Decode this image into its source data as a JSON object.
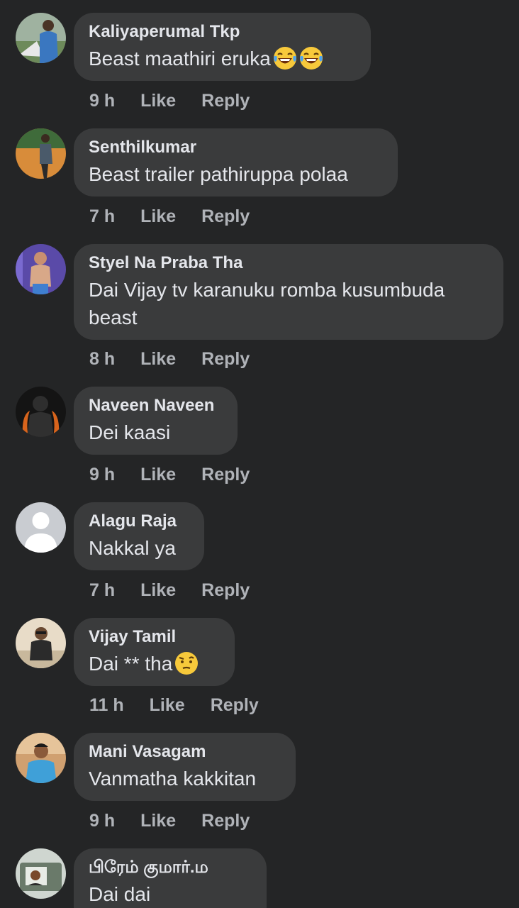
{
  "comments": [
    {
      "author": "Kaliyaperumal Tkp",
      "text": "Beast maathiri eruka",
      "emoji": [
        "face-with-tears-of-joy",
        "face-with-tears-of-joy"
      ],
      "time": "9 h",
      "like": "Like",
      "reply": "Reply"
    },
    {
      "author": "Senthilkumar",
      "text": "Beast trailer pathiruppa polaa",
      "time": "7 h",
      "like": "Like",
      "reply": "Reply"
    },
    {
      "author": "Styel Na Praba Tha",
      "text": "Dai Vijay tv karanuku romba kusumbuda beast",
      "time": "8 h",
      "like": "Like",
      "reply": "Reply"
    },
    {
      "author": "Naveen Naveen",
      "text": "Dei kaasi",
      "time": "9 h",
      "like": "Like",
      "reply": "Reply"
    },
    {
      "author": "Alagu Raja",
      "text": "Nakkal ya",
      "time": "7 h",
      "like": "Like",
      "reply": "Reply"
    },
    {
      "author": "Vijay Tamil",
      "text": "Dai ** tha",
      "emoji": [
        "face-with-raised-eyebrow"
      ],
      "time": "11 h",
      "like": "Like",
      "reply": "Reply"
    },
    {
      "author": "Mani Vasagam",
      "text": "Vanmatha kakkitan",
      "time": "9 h",
      "like": "Like",
      "reply": "Reply"
    },
    {
      "author": "பிரேம் குமார்.ம",
      "text": "Dai dai"
    }
  ],
  "colors": {
    "background": "#242526",
    "bubble": "#3a3b3c",
    "primary_text": "#e4e6eb",
    "secondary_text": "#b0b3b8"
  }
}
